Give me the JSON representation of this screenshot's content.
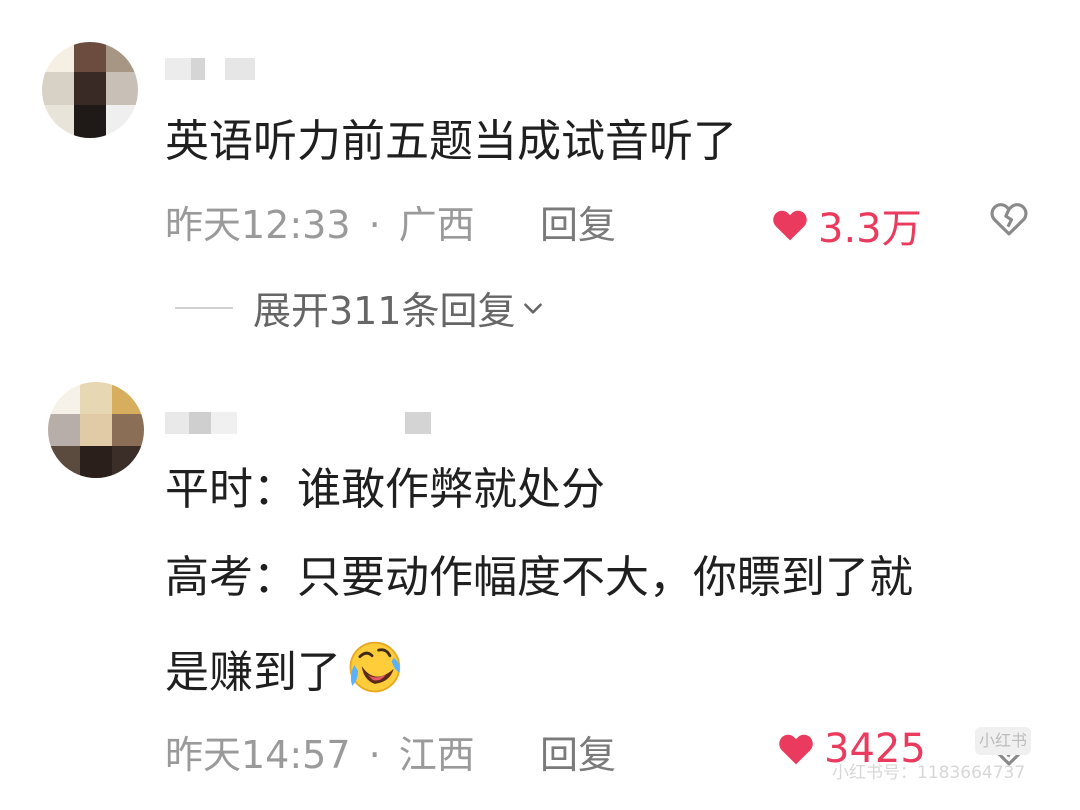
{
  "comments": [
    {
      "lines": [
        "英语听力前五题当成试音听了"
      ],
      "time": "昨天12:33",
      "sep": "·",
      "location": "广西",
      "reply_label": "回复",
      "likes": "3.3万",
      "expand_label": "展开311条回复",
      "avatar_icon": "pixelated-avatar",
      "username_icon": "pixelated-username"
    },
    {
      "lines": [
        "平时：谁敢作弊就处分",
        "高考：只要动作幅度不大，你瞟到了就",
        "是赚到了"
      ],
      "emoji_icon": "rolling-laughing-emoji",
      "time": "昨天14:57",
      "sep": "·",
      "location": "江西",
      "reply_label": "回复",
      "likes": "3425",
      "avatar_icon": "pixelated-avatar",
      "username_icon": "pixelated-username"
    }
  ],
  "icons": {
    "like": "heart-icon",
    "dislike": "broken-heart-icon",
    "expand": "chevron-down-icon"
  },
  "colors": {
    "like": "#ea3a5d",
    "meta": "#9a9a9a",
    "text": "#1f1f1f"
  },
  "watermark": {
    "text": "小红书号：1183664737",
    "badge": "小红书"
  }
}
